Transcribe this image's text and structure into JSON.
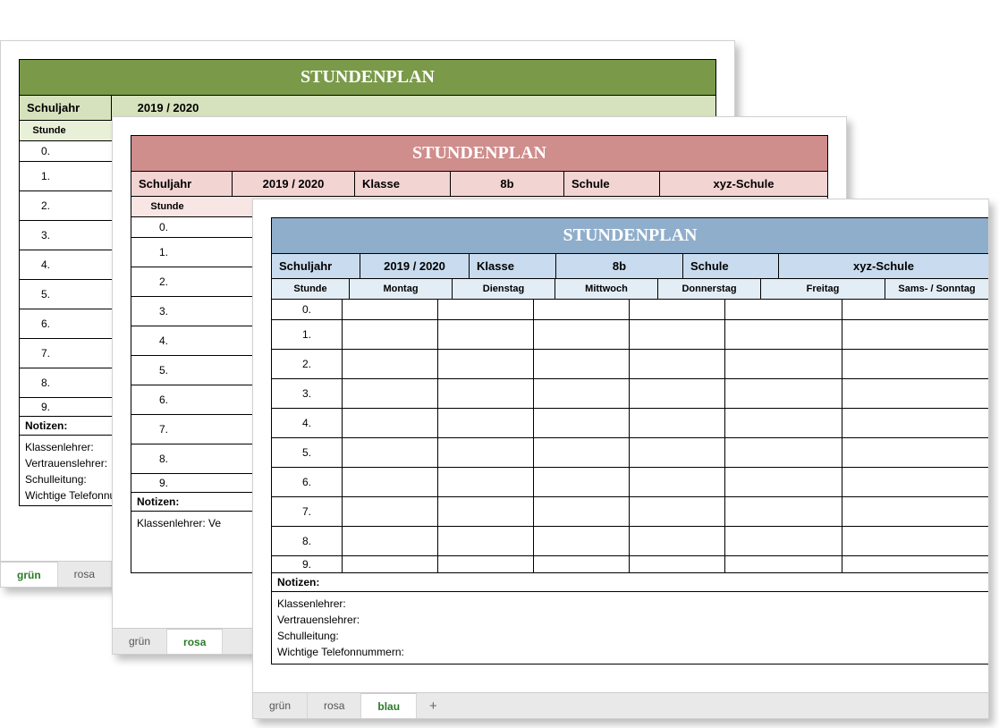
{
  "title": "STUNDENPLAN",
  "meta": {
    "schuljahr_label": "Schuljahr",
    "schuljahr_value": "2019 / 2020",
    "klasse_label": "Klasse",
    "klasse_value": "8b",
    "schule_label": "Schule",
    "schule_value": "xyz-Schule"
  },
  "columns": [
    "Stunde",
    "Montag",
    "Dienstag",
    "Mittwoch",
    "Donnerstag",
    "Freitag",
    "Sams- / Sonntag"
  ],
  "periods": [
    "0.",
    "1.",
    "2.",
    "3.",
    "4.",
    "5.",
    "6.",
    "7.",
    "8.",
    "9."
  ],
  "notes_label": "Notizen:",
  "notes_lines": [
    "Klassenlehrer:",
    "Vertrauenslehrer:",
    "Schulleitung:",
    "Wichtige Telefonnummern:"
  ],
  "notes_short": "Klassenlehrer: Ve",
  "tabs_green": [
    "grün",
    "rosa"
  ],
  "tabs_rose": [
    "grün",
    "rosa"
  ],
  "tabs_blue": [
    "grün",
    "rosa",
    "blau"
  ],
  "plus": "+",
  "colors": {
    "green_title": "#7a9a4a",
    "green_head": "#d6e2bd",
    "rose_title": "#cf8d8c",
    "rose_head": "#f2d4d2",
    "blue_title": "#8faecb",
    "blue_head": "#c9dbee"
  }
}
